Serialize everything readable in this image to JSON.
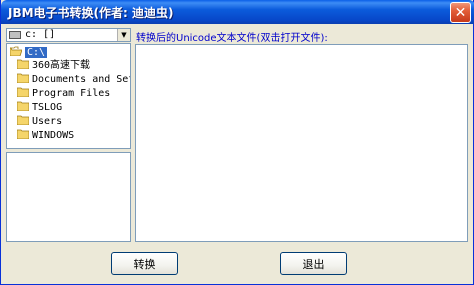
{
  "window": {
    "title": "JBM电子书转换(作者: 迪迪虫)",
    "close_label": "✕"
  },
  "drive": {
    "selected": "c: []"
  },
  "tree": {
    "items": [
      {
        "label": "C:\\",
        "icon": "open-folder-icon",
        "selected": true
      },
      {
        "label": "360高速下载",
        "icon": "folder-icon"
      },
      {
        "label": "Documents and Setti",
        "icon": "folder-icon"
      },
      {
        "label": "Program Files",
        "icon": "folder-icon"
      },
      {
        "label": "TSLOG",
        "icon": "folder-icon"
      },
      {
        "label": "Users",
        "icon": "folder-icon"
      },
      {
        "label": "WINDOWS",
        "icon": "folder-icon"
      }
    ]
  },
  "output": {
    "label": "转换后的Unicode文本文件(双击打开文件):"
  },
  "buttons": {
    "convert": "转换",
    "exit": "退出"
  },
  "colors": {
    "titlebar": "#0b5bdc",
    "selection": "#316ac5",
    "label_blue": "#0000cc",
    "folder": "#f5d56a"
  }
}
